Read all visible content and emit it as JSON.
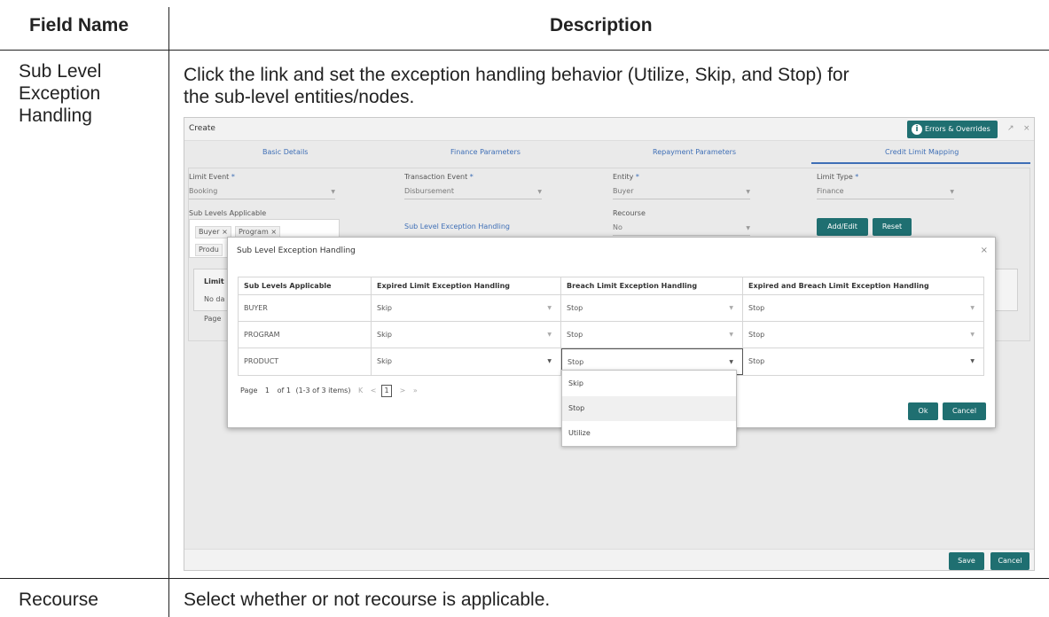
{
  "doc": {
    "col_field": "Field Name",
    "col_desc": "Description",
    "row1_field_line1": "Sub Level",
    "row1_field_line2": "Exception",
    "row1_field_line3": "Handling",
    "row1_desc_line1": "Click the link and set the exception handling behavior (Utilize, Skip, and Stop) for",
    "row1_desc_line2": "the sub-level entities/nodes.",
    "row2_field": "Recourse",
    "row2_desc": "Select whether or not recourse is applicable."
  },
  "app": {
    "title": "Create",
    "errors_button": "Errors & Overrides",
    "info_glyph": "i",
    "minimize_glyph": "↗",
    "close_glyph": "×",
    "tabs": [
      "Basic Details",
      "Finance Parameters",
      "Repayment Parameters",
      "Credit Limit Mapping"
    ],
    "form": {
      "limit_event_label": "Limit Event",
      "limit_event_value": "Booking",
      "transaction_event_label": "Transaction Event",
      "transaction_event_value": "Disbursement",
      "entity_label": "Entity",
      "entity_value": "Buyer",
      "limit_type_label": "Limit Type",
      "limit_type_value": "Finance",
      "required_mark": "*",
      "sub_levels_label": "Sub Levels Applicable",
      "chips": [
        "Buyer",
        "Program",
        "Produ"
      ],
      "chip_x": "×",
      "sub_level_link": "Sub Level Exception Handling",
      "recourse_label": "Recourse",
      "recourse_value": "No",
      "add_edit_button": "Add/Edit",
      "reset_button": "Reset",
      "bg_limit": "Limit I",
      "bg_no_data": "No da",
      "bg_page": "Page"
    },
    "footer": {
      "save": "Save",
      "cancel": "Cancel"
    },
    "dropdown_glyph": "▼"
  },
  "modal": {
    "title": "Sub Level Exception Handling",
    "close": "×",
    "headers": [
      "Sub Levels Applicable",
      "Expired Limit Exception Handling",
      "Breach Limit Exception Handling",
      "Expired and Breach Limit Exception Handling"
    ],
    "rows": [
      {
        "level": "BUYER",
        "expired": "Skip",
        "breach": "Stop",
        "both": "Stop"
      },
      {
        "level": "PROGRAM",
        "expired": "Skip",
        "breach": "Stop",
        "both": "Stop"
      },
      {
        "level": "PRODUCT",
        "expired": "Skip",
        "breach": "Stop",
        "both": "Stop"
      }
    ],
    "pager": {
      "page_label": "Page",
      "page_num": "1",
      "of": "of 1",
      "items": "(1-3 of 3 items)",
      "first": "K",
      "prev": "<",
      "current": "1",
      "next": ">",
      "last": "»"
    },
    "ok_button": "Ok",
    "cancel_button": "Cancel",
    "dropdown_options": [
      "Skip",
      "Stop",
      "Utilize"
    ]
  },
  "colors": {
    "teal": "#1f6f71",
    "link_blue": "#3f6fb6"
  }
}
